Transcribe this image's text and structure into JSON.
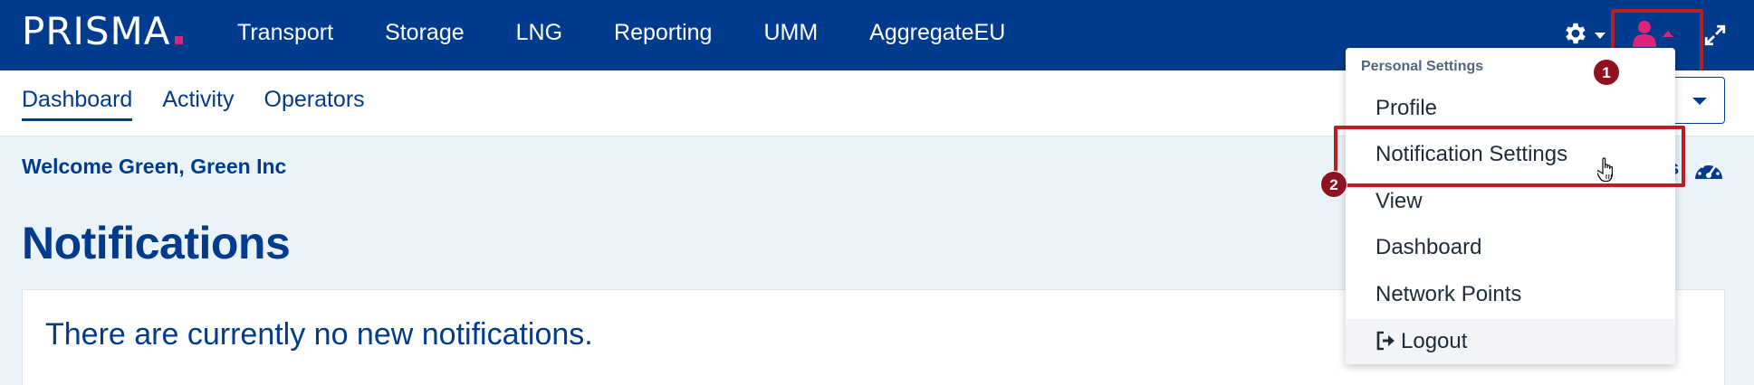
{
  "header": {
    "logo": "PRISMA",
    "nav": [
      "Transport",
      "Storage",
      "LNG",
      "Reporting",
      "UMM",
      "AggregateEU"
    ],
    "icons": {
      "settings": "gear-icon",
      "user": "user-icon",
      "expand": "expand-icon"
    }
  },
  "subnav": {
    "items": [
      "Dashboard",
      "Activity",
      "Operators"
    ],
    "active": "Dashboard"
  },
  "main": {
    "welcome": "Welcome Green, Green Inc",
    "partial_right_text": "s",
    "title": "Notifications",
    "empty_message": "There are currently no new notifications."
  },
  "user_menu": {
    "header": "Personal Settings",
    "items": [
      "Profile",
      "Notification Settings",
      "View",
      "Dashboard",
      "Network Points",
      "Logout"
    ]
  },
  "annotations": {
    "badge1": "1",
    "badge2": "2"
  },
  "colors": {
    "brand_blue": "#003b8e",
    "accent_pink": "#e0237a",
    "annotation_red": "#b52025",
    "page_bg": "#eaf3fa"
  }
}
